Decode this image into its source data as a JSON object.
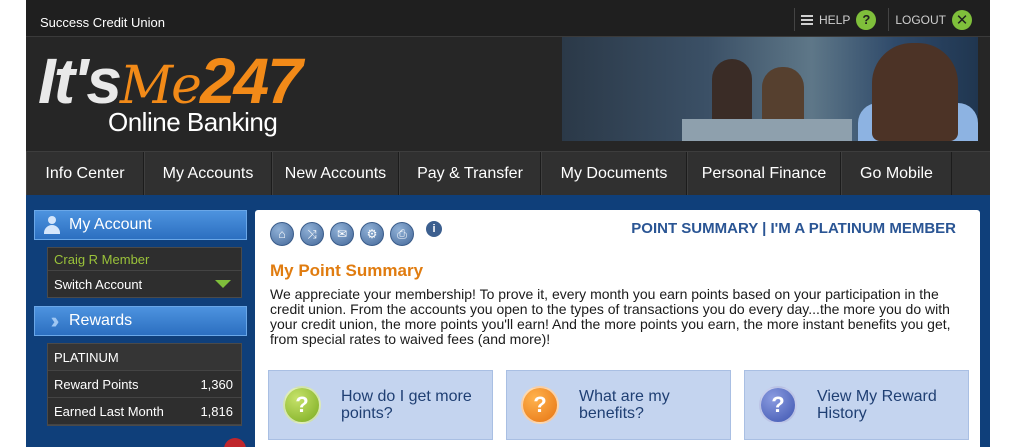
{
  "topbar": {
    "cu_name": "Success Credit Union",
    "help_label": "HELP",
    "help_icon_glyph": "?",
    "logout_label": "LOGOUT",
    "logout_icon_glyph": "✕"
  },
  "header": {
    "logo_its": "It's",
    "logo_me": "Me",
    "logo_247": "247",
    "logo_sub": "Online Banking"
  },
  "nav": [
    "Info Center",
    "My Accounts",
    "New Accounts",
    "Pay & Transfer",
    "My Documents",
    "Personal Finance",
    "Go Mobile"
  ],
  "sidebar": {
    "my_account_label": "My Account",
    "member_name": "Craig R Member",
    "switch_account_label": "Switch Account",
    "rewards_label": "Rewards",
    "tier": "PLATINUM",
    "rows": [
      {
        "label": "Reward Points",
        "value": "1,360"
      },
      {
        "label": "Earned Last Month",
        "value": "1,816"
      }
    ]
  },
  "main": {
    "point_heading": "POINT SUMMARY | I'M A PLATINUM MEMBER",
    "summary_title": "My Point Summary",
    "summary_text": "We appreciate your membership! To prove it, every month you earn points based on your participation in the credit union. From the accounts you open to the types of transactions you do every day...the more you do with your credit union, the more points you'll earn! And the more points you earn, the more instant benefits you get, from special rates to waived fees (and more)!",
    "info_glyph": "i",
    "tools": [
      "home-icon",
      "shuffle-icon",
      "mail-icon",
      "gear-icon",
      "printer-icon"
    ],
    "cards": [
      {
        "glyph": "?",
        "label": "How do I get more points?",
        "color": "#7aab1f"
      },
      {
        "glyph": "?",
        "label": "What are my benefits?",
        "color": "#e67412"
      },
      {
        "glyph": "?",
        "label": "View My Reward History",
        "color": "#3e55b0"
      }
    ]
  },
  "colors": {
    "accent_orange": "#e07c10",
    "heading_blue": "#2a5594",
    "member_green": "#9ac23a",
    "body_bg": "#0f3f7a"
  }
}
